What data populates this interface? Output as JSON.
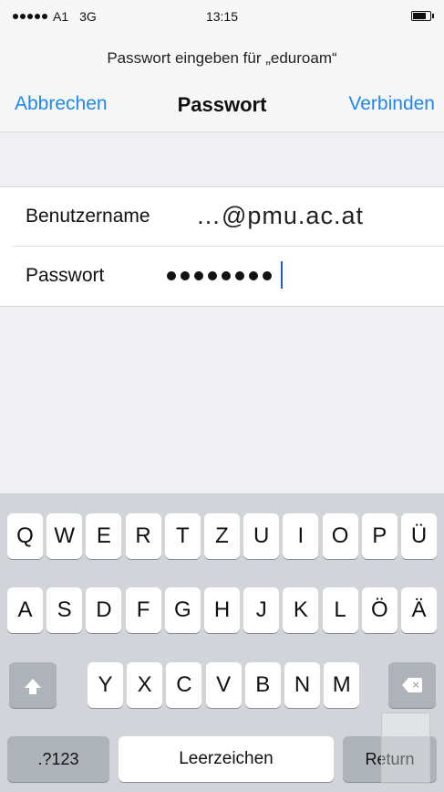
{
  "status": {
    "carrier": "A1",
    "network": "3G",
    "time": "13:15",
    "battery_level": 0.75
  },
  "header": {
    "subtitle": "Passwort eingeben für „eduroam“",
    "cancel_label": "Abbrechen",
    "title": "Passwort",
    "connect_label": "Verbinden"
  },
  "form": {
    "username_label": "Benutzername",
    "username_value": "…@pmu.ac.at",
    "password_label": "Passwort",
    "password_length": 8
  },
  "keyboard": {
    "row1": [
      "Q",
      "W",
      "E",
      "R",
      "T",
      "Z",
      "U",
      "I",
      "O",
      "P",
      "Ü"
    ],
    "row2": [
      "A",
      "S",
      "D",
      "F",
      "G",
      "H",
      "J",
      "K",
      "L",
      "Ö",
      "Ä"
    ],
    "row3": [
      "Y",
      "X",
      "C",
      "V",
      "B",
      "N",
      "M"
    ],
    "numbers_label": ".?123",
    "space_label": "Leerzeichen",
    "return_label": "Return",
    "shift_icon": "shift-icon",
    "backspace_icon": "backspace-icon"
  },
  "colors": {
    "accent": "#1e88f0",
    "background": "#efeff4",
    "keyboard": "#d1d4d9"
  }
}
